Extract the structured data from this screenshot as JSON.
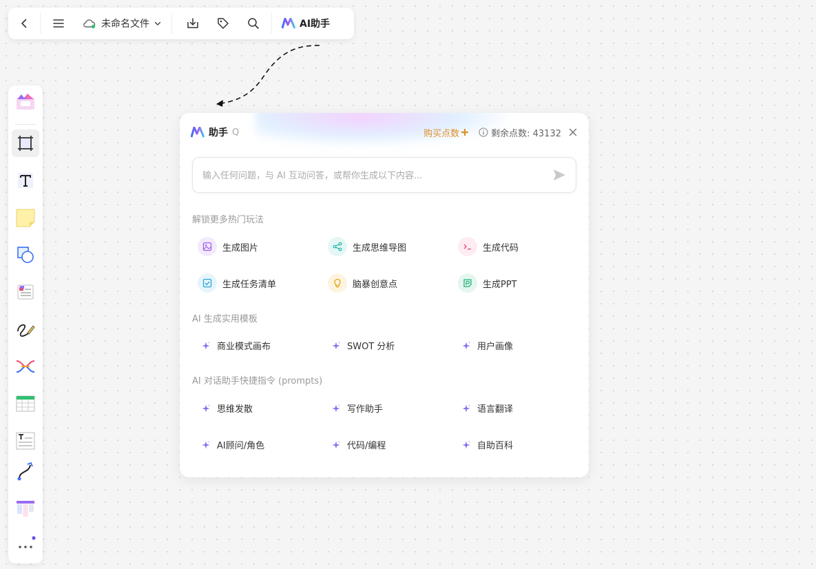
{
  "topbar": {
    "file_name": "未命名文件",
    "ai_label": "AI助手"
  },
  "sidebar": {
    "items": [
      "logo",
      "frame",
      "text",
      "sticky-note",
      "shape",
      "template",
      "pen",
      "mindmap",
      "table",
      "text-box",
      "connector",
      "kanban",
      "more"
    ]
  },
  "panel": {
    "title": "助手",
    "hotkey": "Q",
    "buy_label": "购买点数",
    "remaining_label": "剩余点数: 43132",
    "input_placeholder": "输入任何问题，与 AI 互动问答，或帮你生成以下内容...",
    "section1_title": "解锁更多热门玩法",
    "hot_actions": [
      {
        "label": "生成图片",
        "icon": "image-icon",
        "color": "#a25ee8",
        "bg": "#f3eafd"
      },
      {
        "label": "生成思维导图",
        "icon": "mindmap-icon",
        "color": "#1fb6a8",
        "bg": "#e4f7f5"
      },
      {
        "label": "生成代码",
        "icon": "code-icon",
        "color": "#e3507a",
        "bg": "#fdecf1"
      },
      {
        "label": "生成任务清单",
        "icon": "checklist-icon",
        "color": "#2aa6d8",
        "bg": "#e6f5fb"
      },
      {
        "label": "脑暴创意点",
        "icon": "bulb-icon",
        "color": "#e6a317",
        "bg": "#fdf4e0"
      },
      {
        "label": "生成PPT",
        "icon": "ppt-icon",
        "color": "#22b47a",
        "bg": "#e5f6ee"
      }
    ],
    "section2_title": "AI 生成实用模板",
    "templates": [
      "商业模式画布",
      "SWOT 分析",
      "用户画像"
    ],
    "section3_title": "AI 对话助手快捷指令 (prompts)",
    "prompts": [
      "思维发散",
      "写作助手",
      "语言翻译",
      "AI顾问/角色",
      "代码/编程",
      "自助百科"
    ]
  }
}
